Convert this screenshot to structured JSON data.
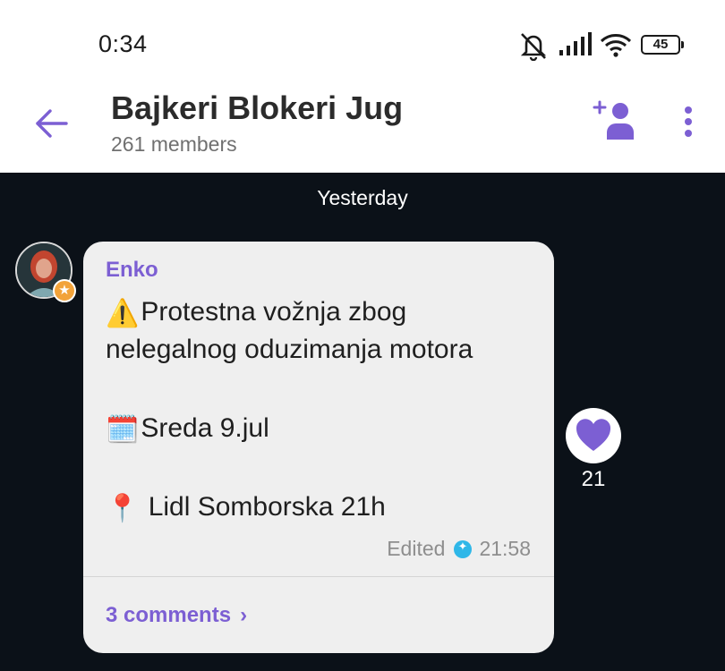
{
  "status_bar": {
    "time": "0:34",
    "battery": "45",
    "icons": [
      "muted-bell-icon",
      "signal-icon",
      "wifi-icon",
      "battery-icon"
    ]
  },
  "header": {
    "title": "Bajkeri Blokeri Jug",
    "subtitle": "261 members",
    "icons": [
      "back-arrow-icon",
      "add-member-icon",
      "more-vertical-icon"
    ],
    "accent": "#7c5fd3"
  },
  "chat": {
    "date_separator": "Yesterday",
    "message": {
      "sender": "Enko",
      "lines": [
        {
          "emoji": "⚠️",
          "text": "Protestna vožnja zbog"
        },
        {
          "emoji": "",
          "text": "nelegalnog oduzimanja motora"
        },
        {
          "emoji": "🗓️",
          "text": "Sreda 9.jul"
        },
        {
          "emoji": "📍",
          "text": " Lidl Somborska 21h"
        }
      ],
      "edited_label": "Edited",
      "time": "21:58",
      "comments": "3 comments"
    },
    "reaction": {
      "icon": "heart-icon",
      "count": "21",
      "color": "#7c5fd3"
    }
  }
}
